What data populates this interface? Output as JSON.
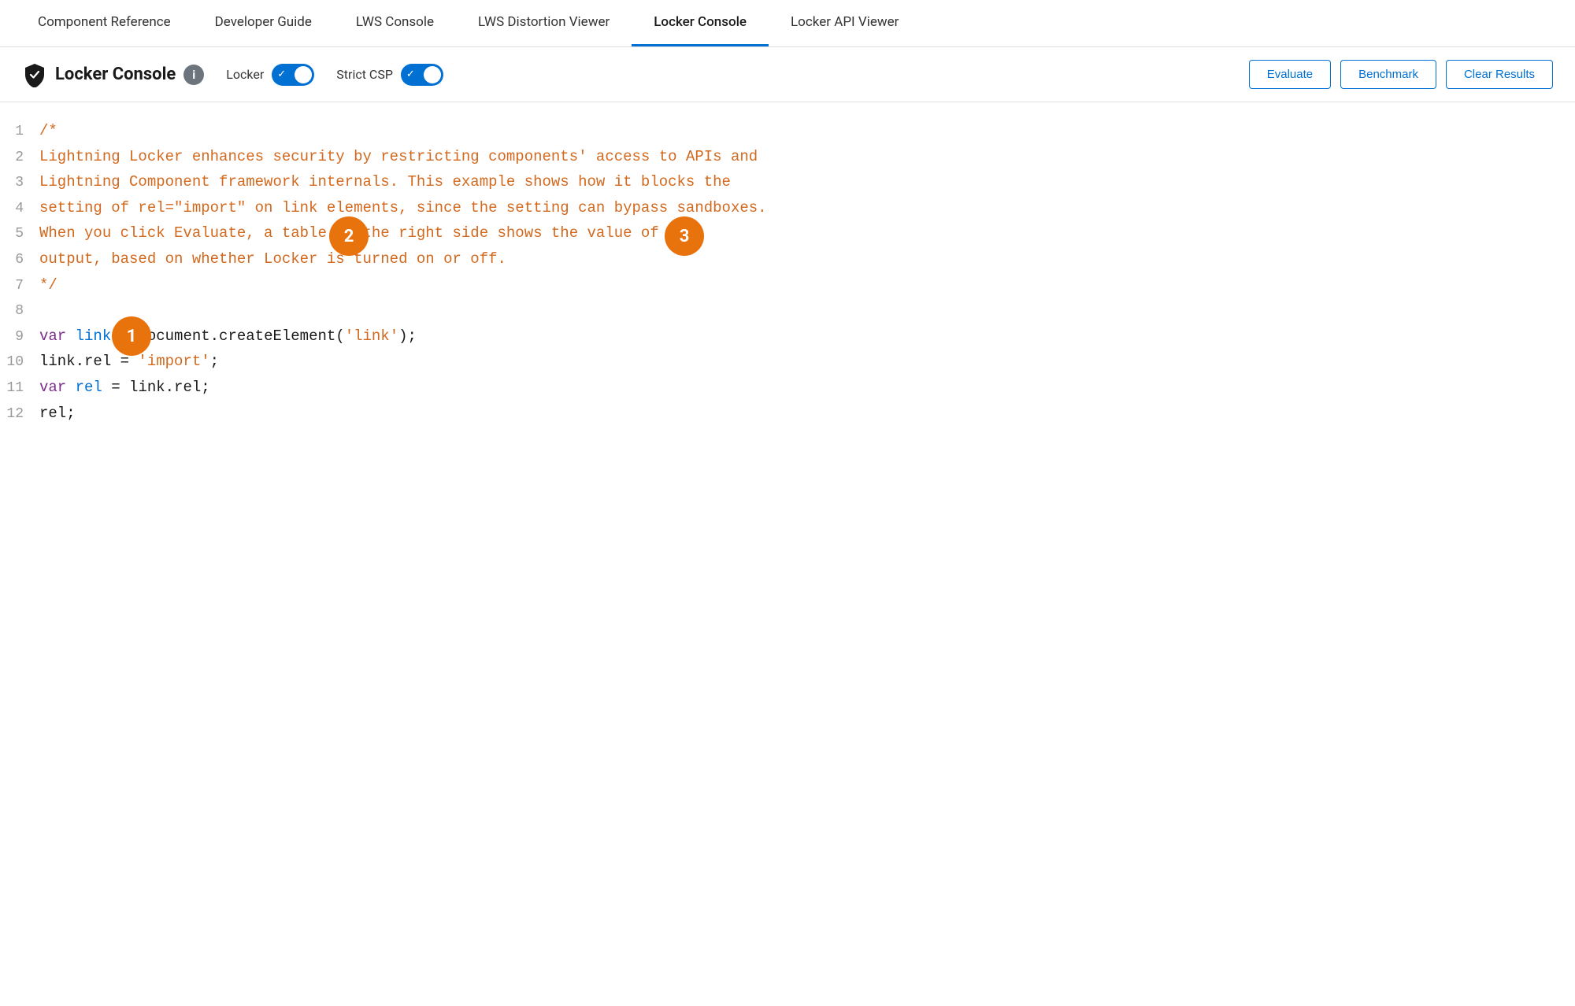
{
  "nav": {
    "tabs": [
      {
        "id": "component-reference",
        "label": "Component Reference",
        "active": false
      },
      {
        "id": "developer-guide",
        "label": "Developer Guide",
        "active": false
      },
      {
        "id": "lws-console",
        "label": "LWS Console",
        "active": false
      },
      {
        "id": "lws-distortion-viewer",
        "label": "LWS Distortion Viewer",
        "active": false
      },
      {
        "id": "locker-console",
        "label": "Locker Console",
        "active": true
      },
      {
        "id": "locker-api-viewer",
        "label": "Locker API Viewer",
        "active": false
      }
    ]
  },
  "toolbar": {
    "title": "Locker Console",
    "locker_label": "Locker",
    "locker_enabled": true,
    "strict_csp_label": "Strict CSP",
    "strict_csp_enabled": true,
    "evaluate_label": "Evaluate",
    "benchmark_label": "Benchmark",
    "clear_results_label": "Clear Results"
  },
  "code": {
    "lines": [
      {
        "num": 1,
        "type": "comment",
        "content": "/*"
      },
      {
        "num": 2,
        "type": "comment",
        "content": "Lightning Locker enhances security by restricting components' access to APIs and"
      },
      {
        "num": 3,
        "type": "comment",
        "content": "Lightning Component framework internals. This example shows how it blocks the"
      },
      {
        "num": 4,
        "type": "comment",
        "content": "setting of rel=\"import\" on link elements, since the setting can bypass sandboxes."
      },
      {
        "num": 5,
        "type": "comment",
        "content": "When you click Evaluate, a table on the right side shows the value of your"
      },
      {
        "num": 6,
        "type": "comment",
        "content": "output, based on whether Locker is turned on or off."
      },
      {
        "num": 7,
        "type": "comment",
        "content": "*/"
      },
      {
        "num": 8,
        "type": "blank",
        "content": ""
      },
      {
        "num": 9,
        "type": "code",
        "content": "var link = document.createElement('link');"
      },
      {
        "num": 10,
        "type": "code",
        "content": "link.rel = 'import';"
      },
      {
        "num": 11,
        "type": "code",
        "content": "var rel = link.rel;"
      },
      {
        "num": 12,
        "type": "code",
        "content": "rel;"
      }
    ]
  },
  "annotations": [
    {
      "id": "1",
      "label": "1"
    },
    {
      "id": "2",
      "label": "2"
    },
    {
      "id": "3",
      "label": "3"
    }
  ],
  "colors": {
    "active_tab_border": "#0070d2",
    "toggle_on": "#0070d2",
    "button_border": "#0070d2",
    "annotation": "#e8720c",
    "comment": "#d2691e",
    "keyword": "#7b2d8b",
    "variable_blue": "#0070d2",
    "string_orange": "#d2691e",
    "plain": "#1a1a1a"
  }
}
